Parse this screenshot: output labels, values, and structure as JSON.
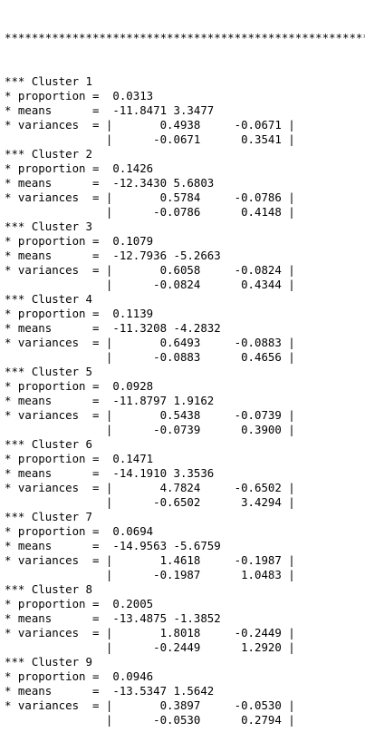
{
  "separator": "******************************************************",
  "clusters": [
    {
      "header": "*** Cluster 1",
      "proportion": "* proportion =  0.0313",
      "means": "* means      =  -11.8471 3.3477",
      "var1": "* variances  = |       0.4938     -0.0671 |",
      "var2": "               |      -0.0671      0.3541 |"
    },
    {
      "header": "*** Cluster 2",
      "proportion": "* proportion =  0.1426",
      "means": "* means      =  -12.3430 5.6803",
      "var1": "* variances  = |       0.5784     -0.0786 |",
      "var2": "               |      -0.0786      0.4148 |"
    },
    {
      "header": "*** Cluster 3",
      "proportion": "* proportion =  0.1079",
      "means": "* means      =  -12.7936 -5.2663",
      "var1": "* variances  = |       0.6058     -0.0824 |",
      "var2": "               |      -0.0824      0.4344 |"
    },
    {
      "header": "*** Cluster 4",
      "proportion": "* proportion =  0.1139",
      "means": "* means      =  -11.3208 -4.2832",
      "var1": "* variances  = |       0.6493     -0.0883 |",
      "var2": "               |      -0.0883      0.4656 |"
    },
    {
      "header": "*** Cluster 5",
      "proportion": "* proportion =  0.0928",
      "means": "* means      =  -11.8797 1.9162",
      "var1": "* variances  = |       0.5438     -0.0739 |",
      "var2": "               |      -0.0739      0.3900 |"
    },
    {
      "header": "*** Cluster 6",
      "proportion": "* proportion =  0.1471",
      "means": "* means      =  -14.1910 3.3536",
      "var1": "* variances  = |       4.7824     -0.6502 |",
      "var2": "               |      -0.6502      3.4294 |"
    },
    {
      "header": "*** Cluster 7",
      "proportion": "* proportion =  0.0694",
      "means": "* means      =  -14.9563 -5.6759",
      "var1": "* variances  = |       1.4618     -0.1987 |",
      "var2": "               |      -0.1987      1.0483 |"
    },
    {
      "header": "*** Cluster 8",
      "proportion": "* proportion =  0.2005",
      "means": "* means      =  -13.4875 -1.3852",
      "var1": "* variances  = |       1.8018     -0.2449 |",
      "var2": "               |      -0.2449      1.2920 |"
    },
    {
      "header": "*** Cluster 9",
      "proportion": "* proportion =  0.0946",
      "means": "* means      =  -13.5347 1.5642",
      "var1": "* variances  = |       0.3897     -0.0530 |",
      "var2": "               |      -0.0530      0.2794 |"
    }
  ]
}
